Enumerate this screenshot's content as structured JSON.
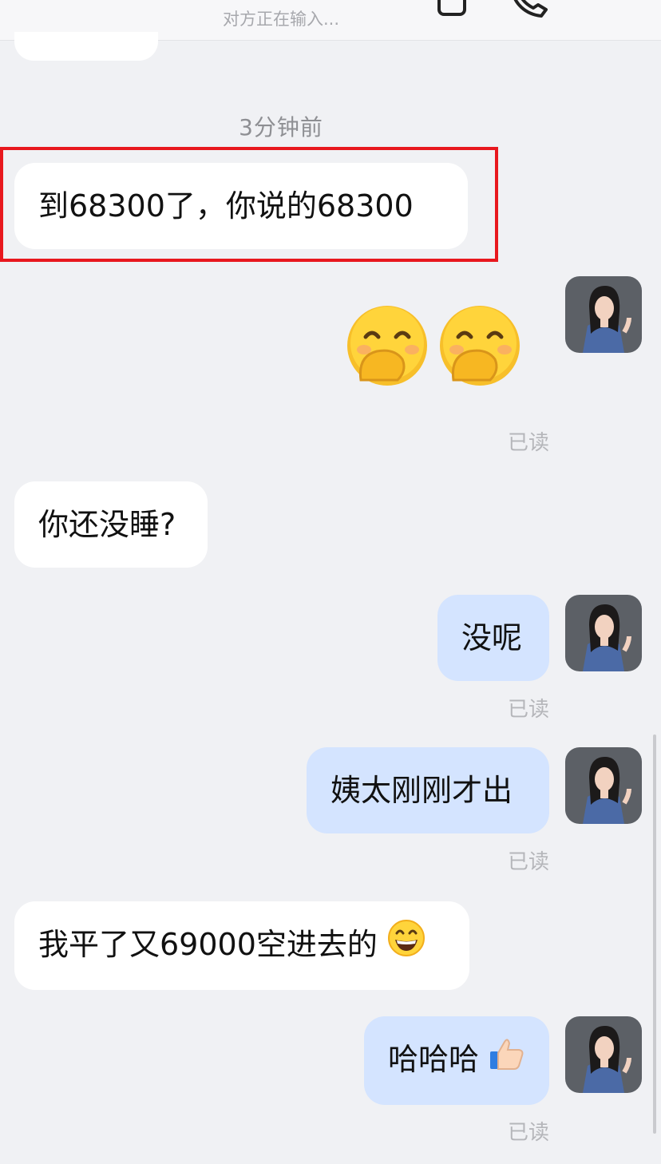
{
  "header": {
    "typing_status": "对方正在输入...",
    "icons": [
      "phone-icon",
      "call-icon",
      "more-icon"
    ]
  },
  "conversation": {
    "timestamp": "3分钟前",
    "messages": [
      {
        "side": "in",
        "text": "到68300了，你说的68300",
        "highlighted": true
      },
      {
        "side": "out",
        "emoji": [
          "face-with-hand-over-mouth-emoji",
          "face-with-hand-over-mouth-emoji"
        ],
        "status": "已读"
      },
      {
        "side": "in",
        "text": "你还没睡?"
      },
      {
        "side": "out",
        "text": "没呢",
        "status": "已读"
      },
      {
        "side": "out",
        "text": "姨太刚刚才出",
        "status": "已读"
      },
      {
        "side": "in",
        "text": "我平了又69000空进去的",
        "trailing_emoji": "grinning-face-emoji"
      },
      {
        "side": "out",
        "text": "哈哈哈",
        "trailing_emoji": "thumbs-up-emoji",
        "status": "已读"
      }
    ]
  },
  "colors": {
    "background": "#f0f1f4",
    "incoming_bubble": "#ffffff",
    "outgoing_bubble": "#d4e4ff",
    "highlight_border": "#e8181e",
    "read_status": "#b5b6ba"
  }
}
